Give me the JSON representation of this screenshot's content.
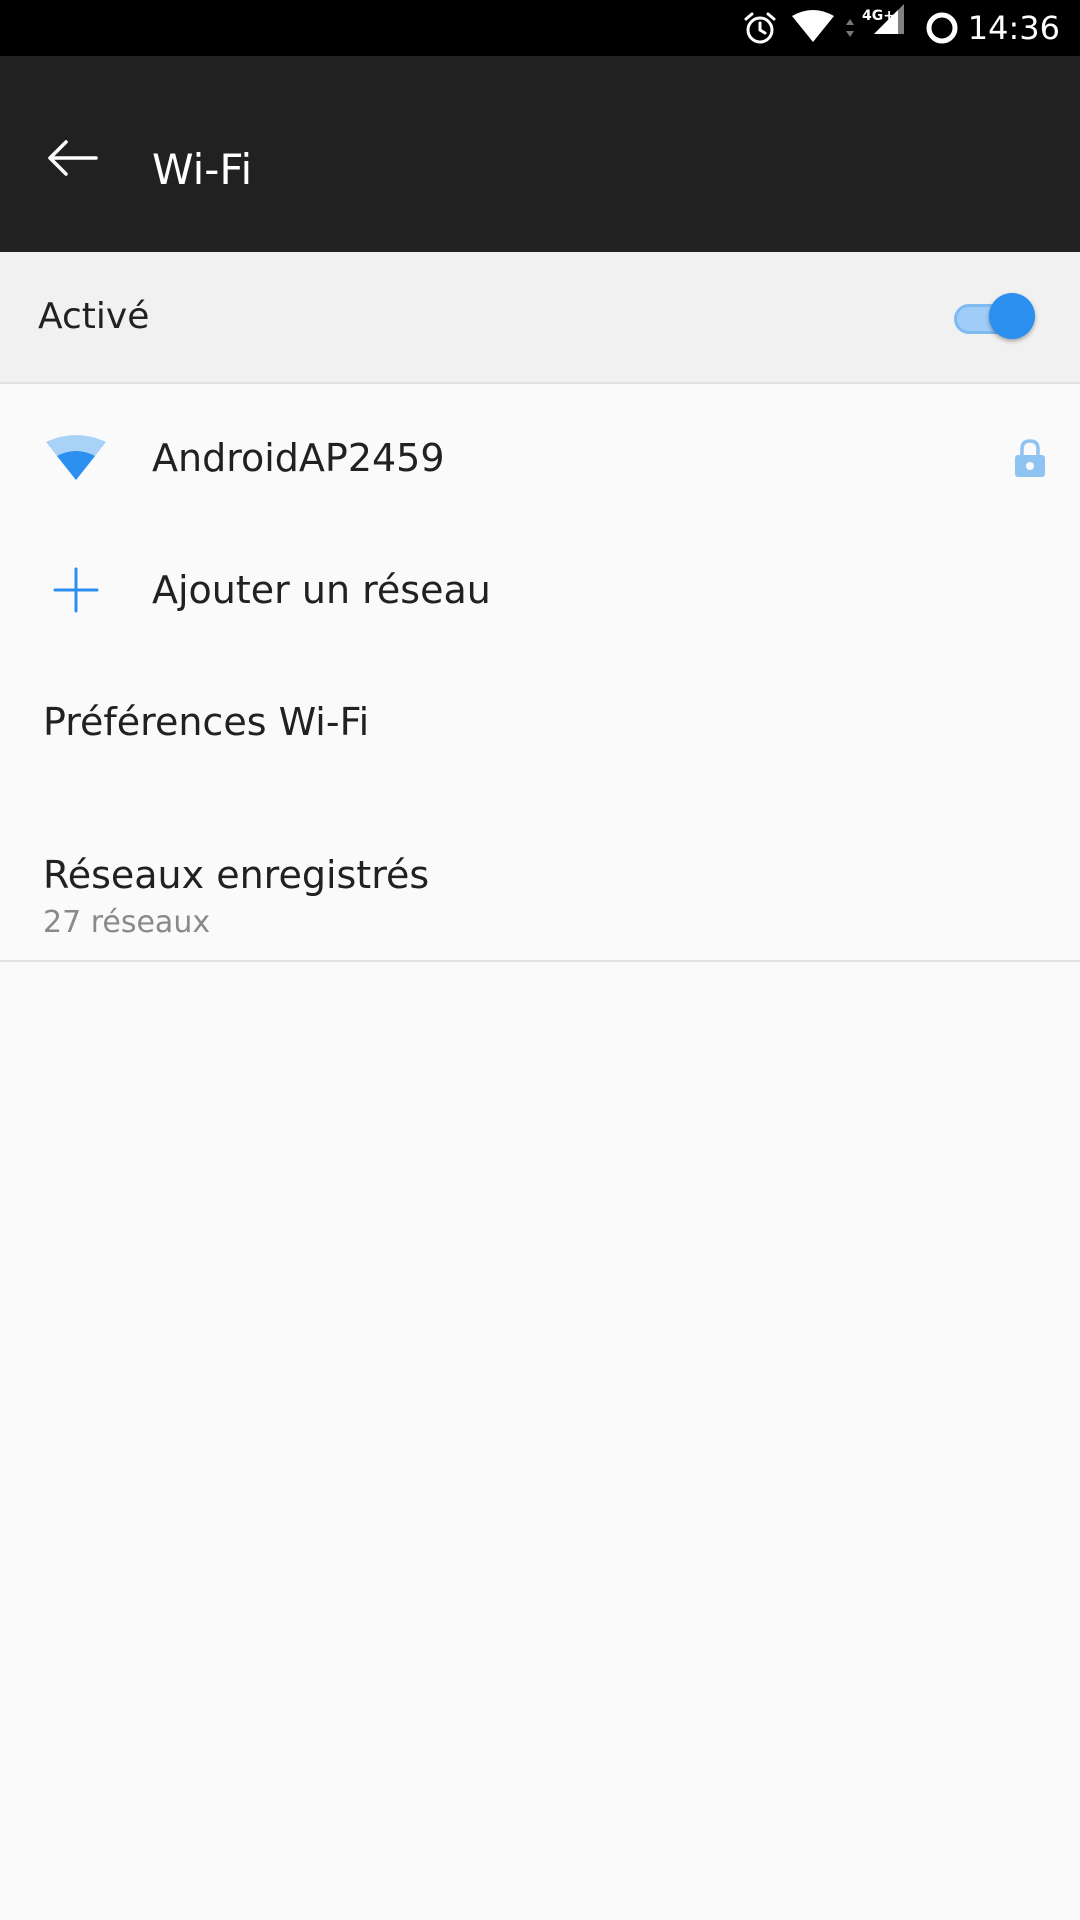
{
  "status_bar": {
    "time": "14:36",
    "network_type": "4G+",
    "icons": [
      "alarm-icon",
      "wifi-signal-icon",
      "data-arrows-icon",
      "cell-signal-icon",
      "ring-icon"
    ]
  },
  "toolbar": {
    "title": "Wi-Fi",
    "back_icon": "arrow-back-icon"
  },
  "master_switch": {
    "label": "Activé",
    "state": "on",
    "accent_color": "#2b8ff0"
  },
  "networks": [
    {
      "ssid": "AndroidAP2459",
      "icon": "wifi-signal-icon",
      "secured": true,
      "lock_icon": "lock-icon"
    }
  ],
  "actions": {
    "add_network_label": "Ajouter un réseau",
    "add_icon": "plus-icon"
  },
  "preferences": {
    "label": "Préférences Wi-Fi"
  },
  "saved_networks": {
    "title": "Réseaux enregistrés",
    "summary": "27 réseaux"
  }
}
